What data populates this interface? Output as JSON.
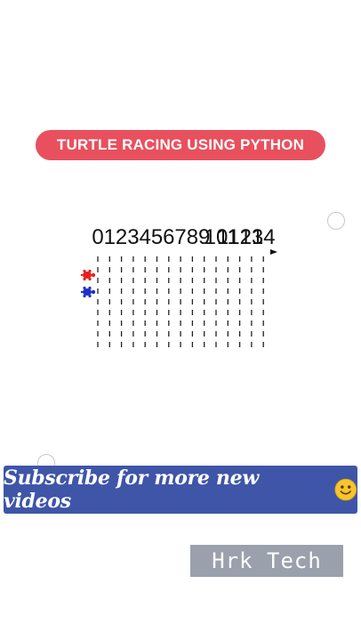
{
  "title_pill": {
    "text": "TURTLE RACING USING PYTHON",
    "color": "#e8505e"
  },
  "race": {
    "lane_numbers": [
      "0",
      "1",
      "2",
      "3",
      "4",
      "5",
      "6",
      "7",
      "8",
      "9",
      "10",
      "11",
      "12",
      "13",
      "14"
    ],
    "turtles": [
      {
        "name": "red",
        "color": "#e52020"
      },
      {
        "name": "blue",
        "color": "#2030c8"
      }
    ]
  },
  "banner": {
    "text": "Subscribe for more new videos",
    "emoji": "smiley-icon",
    "color": "#3f55a8"
  },
  "watermark": {
    "text": "Hrk Tech"
  }
}
